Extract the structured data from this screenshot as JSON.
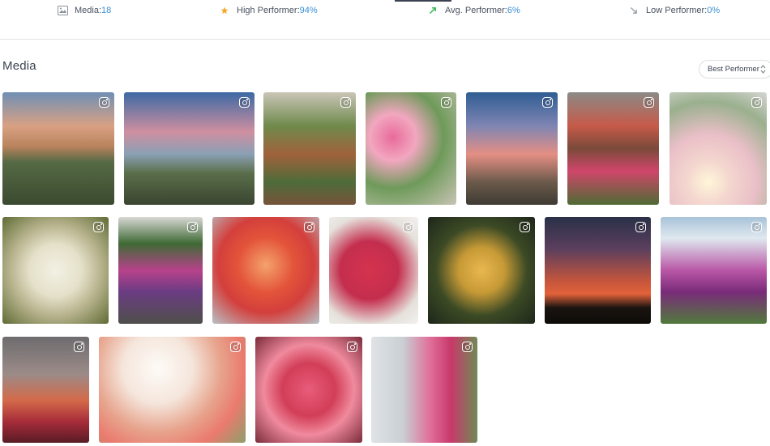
{
  "stats": {
    "media": {
      "label": "Media: ",
      "value": "18",
      "icon": "image-icon"
    },
    "high": {
      "label": "High Performer: ",
      "value": "94%",
      "icon": "star-icon",
      "color": "#f5a623"
    },
    "avg": {
      "label": "Avg. Performer: ",
      "value": "6%",
      "icon": "arrow-up-right-icon",
      "color": "#2fb34a"
    },
    "low": {
      "label": "Low Performer: ",
      "value": "0%",
      "icon": "arrow-down-right-icon",
      "color": "#9aa1a9"
    }
  },
  "section": {
    "title": "Media"
  },
  "sort": {
    "selected": "Best Performer"
  },
  "media_items": [
    {
      "platform": "instagram",
      "subject": "saguaro cacti desert sunset"
    },
    {
      "platform": "instagram",
      "subject": "cactus against pink sky"
    },
    {
      "platform": "instagram",
      "subject": "potted cacti plant shelves"
    },
    {
      "platform": "instagram",
      "subject": "pink bougainvillea on wall"
    },
    {
      "platform": "instagram",
      "subject": "saguaro cactus pink sky"
    },
    {
      "platform": "instagram",
      "subject": "balconies with flowers"
    },
    {
      "platform": "instagram",
      "subject": "cosmos flowers sunlight"
    },
    {
      "platform": "instagram",
      "subject": "white daisies"
    },
    {
      "platform": "instagram",
      "subject": "flower covered house"
    },
    {
      "platform": "instagram",
      "subject": "orange bougainvillea"
    },
    {
      "platform": "instagram",
      "subject": "red roses on white fence"
    },
    {
      "platform": "instagram",
      "subject": "yellow roses"
    },
    {
      "platform": "instagram",
      "subject": "cacti silhouettes sunset"
    },
    {
      "platform": "instagram",
      "subject": "pink wildflowers by the sea"
    },
    {
      "platform": "instagram",
      "subject": "red flowers at dusk"
    },
    {
      "platform": "instagram",
      "subject": "pink blossoms bright sky"
    },
    {
      "platform": "instagram",
      "subject": "pink bougainvillea close-up"
    },
    {
      "platform": "instagram",
      "subject": "bougainvillea over white fence"
    }
  ]
}
